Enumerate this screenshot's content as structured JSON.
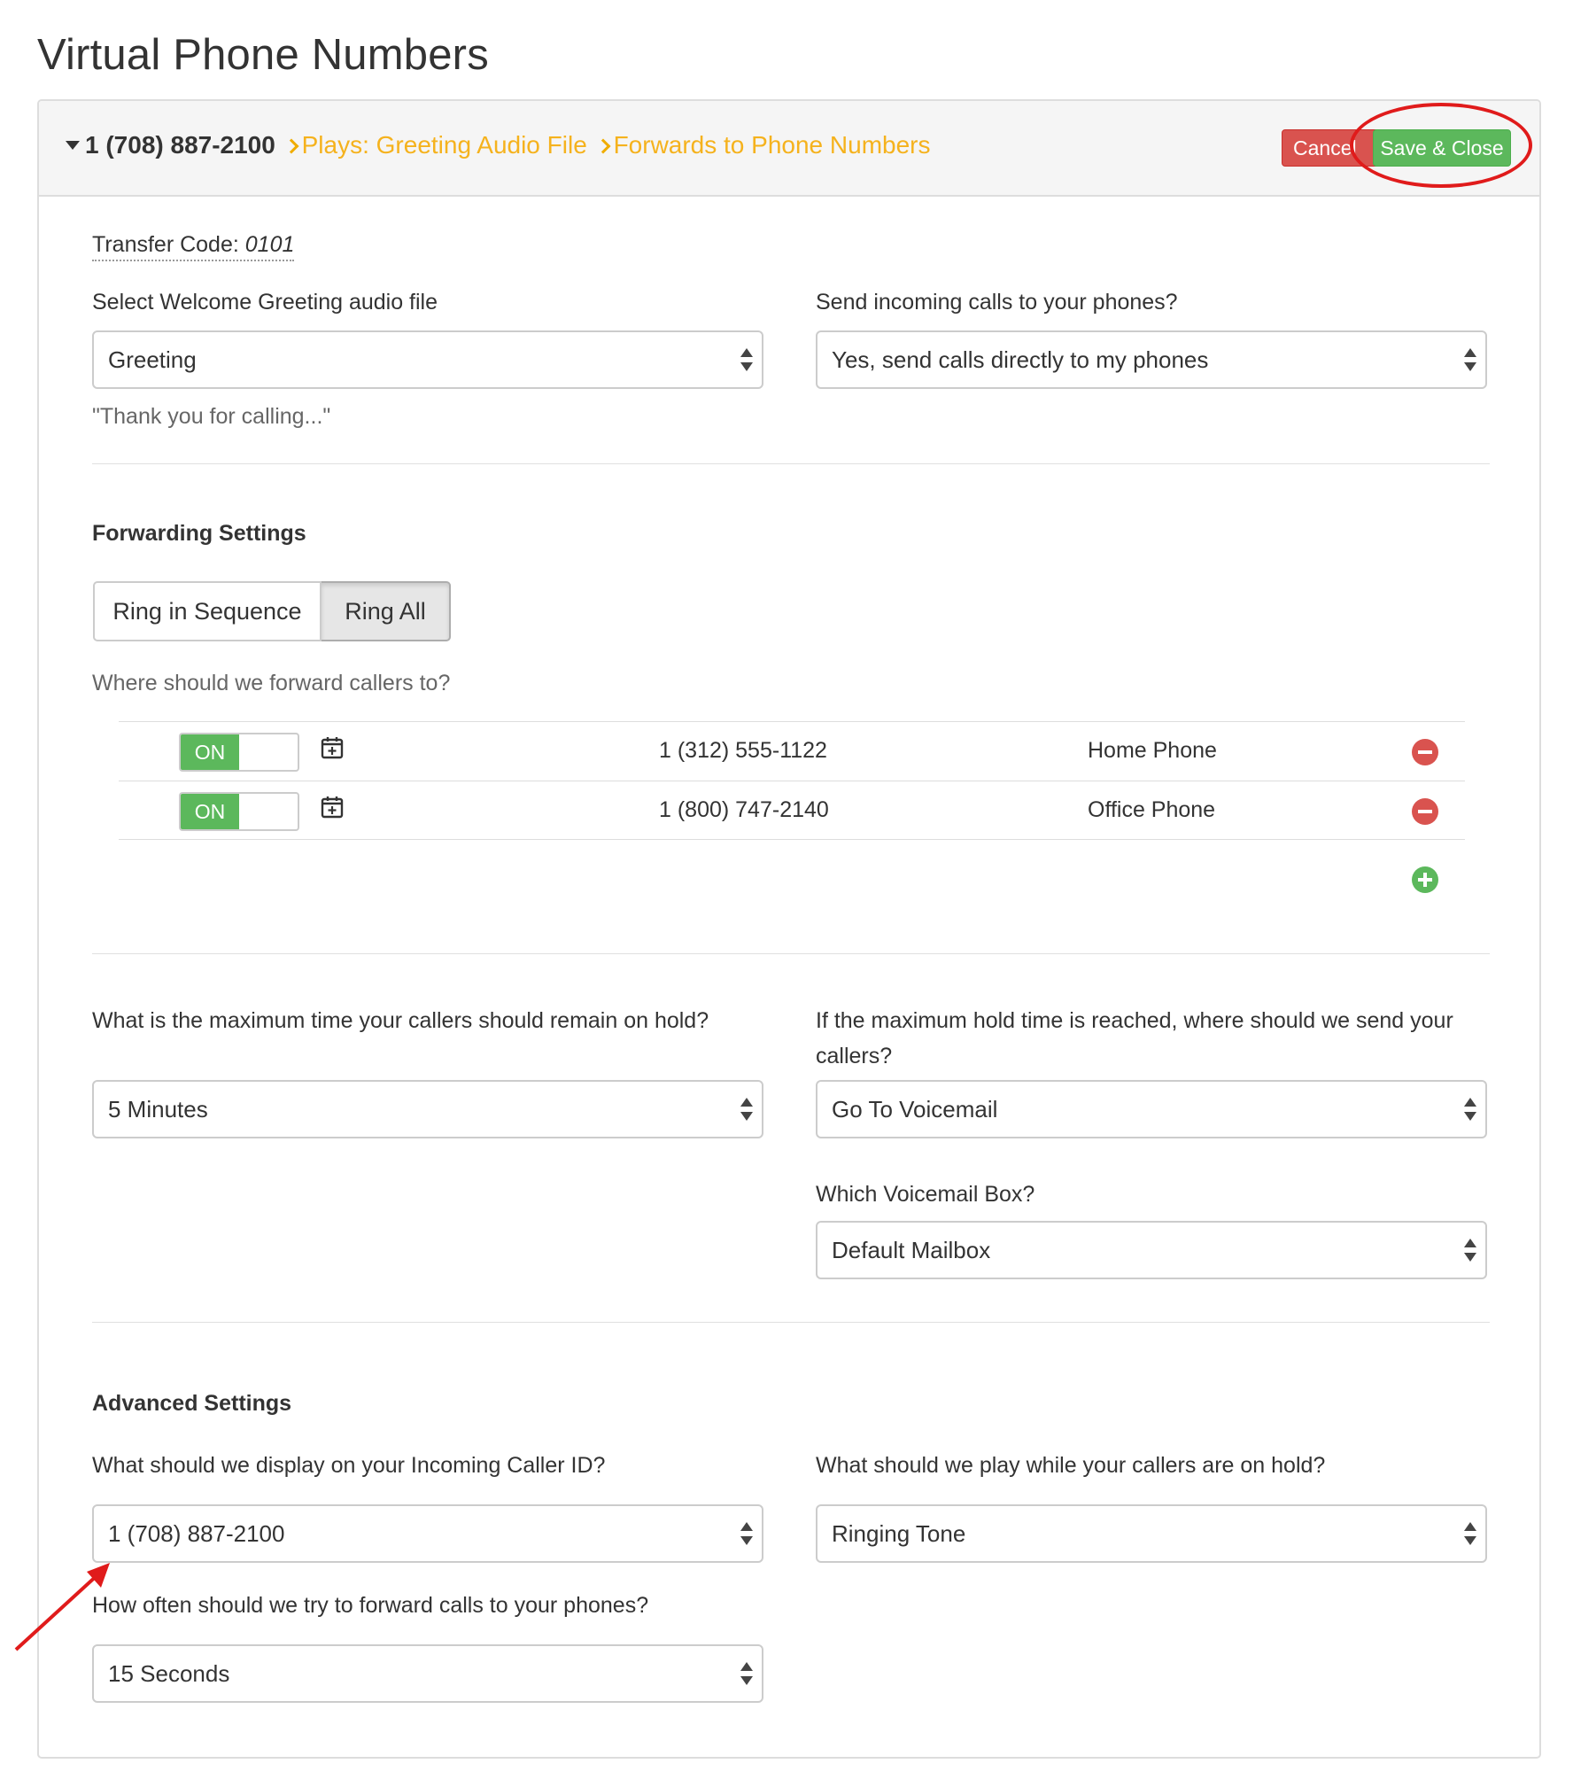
{
  "page": {
    "title": "Virtual Phone Numbers"
  },
  "header": {
    "number": "1 (708) 887-2100",
    "crumb_greeting": "Plays: Greeting Audio File",
    "crumb_forwards": "Forwards to Phone Numbers",
    "cancel_label": "Cancel",
    "save_label": "Save & Close"
  },
  "general": {
    "transfer_label": "Transfer Code:",
    "transfer_code": "0101",
    "greeting_label": "Select Welcome Greeting audio file",
    "greeting_value": "Greeting",
    "greeting_preview": "\"Thank you for calling...\"",
    "send_label": "Send incoming calls to your phones?",
    "send_value": "Yes, send calls directly to my phones"
  },
  "forwarding": {
    "title": "Forwarding Settings",
    "mode_sequence": "Ring in Sequence",
    "mode_all": "Ring All",
    "active_mode": "Ring All",
    "where_label": "Where should we forward callers to?",
    "rows": [
      {
        "toggle": "ON",
        "number": "1 (312) 555-1122",
        "label": "Home Phone"
      },
      {
        "toggle": "ON",
        "number": "1 (800) 747-2140",
        "label": "Office Phone"
      }
    ]
  },
  "hold": {
    "max_time_label": "What is the maximum time your callers should remain on hold?",
    "max_time_value": "5 Minutes",
    "reached_label": "If the maximum hold time is reached, where should we send your callers?",
    "reached_value": "Go To Voicemail",
    "voicemail_label": "Which Voicemail Box?",
    "voicemail_value": "Default Mailbox"
  },
  "advanced": {
    "title": "Advanced Settings",
    "caller_id_label": "What should we display on your Incoming Caller ID?",
    "caller_id_value": "1 (708) 887-2100",
    "hold_play_label": "What should we play while your callers are on hold?",
    "hold_play_value": "Ringing Tone",
    "retry_label": "How often should we try to forward calls to your phones?",
    "retry_value": "15 Seconds"
  },
  "colors": {
    "accent_orange": "#f5b21d",
    "success_green": "#5cb85c",
    "danger_red": "#d9534f",
    "annotation_red": "#e01b1b"
  }
}
